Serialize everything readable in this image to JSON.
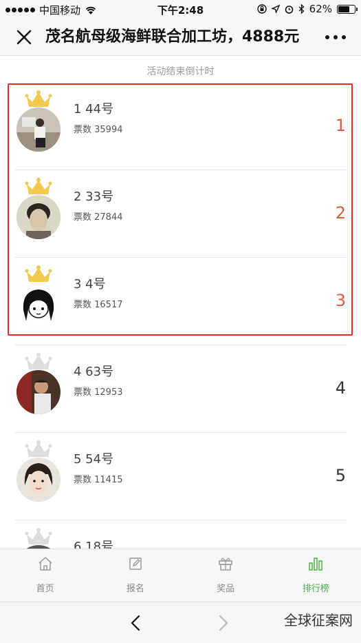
{
  "status_bar": {
    "carrier": "中国移动",
    "time": "下午2:48",
    "battery": "62%",
    "battery_level": 0.62
  },
  "nav": {
    "title": "茂名航母级海鲜联合加工坊，4888元"
  },
  "subheader": "活动结束倒计时",
  "rankings": [
    {
      "name": "1  44号",
      "votes": "票数 35994",
      "rank": "1"
    },
    {
      "name": "2  33号",
      "votes": "票数 27844",
      "rank": "2"
    },
    {
      "name": "3  4号",
      "votes": "票数 16517",
      "rank": "3"
    },
    {
      "name": "4  63号",
      "votes": "票数 12953",
      "rank": "4"
    },
    {
      "name": "5  54号",
      "votes": "票数 11415",
      "rank": "5"
    },
    {
      "name": "6  18号",
      "votes": "",
      "rank": ""
    }
  ],
  "tabs": [
    {
      "label": "首页",
      "icon": "home-icon"
    },
    {
      "label": "报名",
      "icon": "edit-icon"
    },
    {
      "label": "奖品",
      "icon": "gift-icon"
    },
    {
      "label": "排行榜",
      "icon": "chart-icon"
    }
  ],
  "watermark": "全球征案网",
  "colors": {
    "accent_green": "#47b347",
    "rank_red": "#e05a3a",
    "highlight_red": "#e0302a",
    "crown_gold": "#f2c94c",
    "crown_silver": "#dcdcdc"
  }
}
